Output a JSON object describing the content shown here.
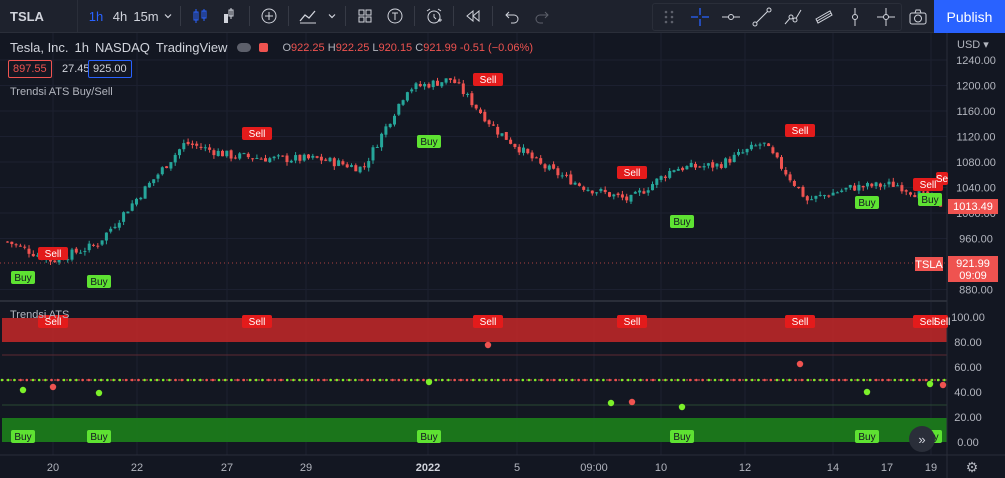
{
  "toolbar": {
    "symbol": "TSLA",
    "timeframes": [
      "1h",
      "4h",
      "15m"
    ],
    "active_timeframe": "1h",
    "publish_label": "Publish",
    "icons": [
      "chevron-down-icon",
      "candles-icon",
      "bars-icon",
      "add-icon",
      "line-chart-icon",
      "layout-icon",
      "templates-icon",
      "alert-icon",
      "replay-icon",
      "undo-icon",
      "redo-icon",
      "grid-dots-icon",
      "crosshair-icon",
      "horizontal-line-icon",
      "trend-line-icon",
      "path-icon",
      "channel-icon",
      "vertical-line-icon",
      "cross-line-icon",
      "camera-icon"
    ]
  },
  "legend": {
    "title": "Tesla, Inc.",
    "interval": "1h",
    "exchange": "NASDAQ",
    "source": "TradingView",
    "o_label": "O",
    "open": "922.25",
    "h_label": "H",
    "high": "922.25",
    "l_label": "L",
    "low": "920.15",
    "c_label": "C",
    "close": "921.99",
    "change": "-0.51 (−0.06%)",
    "bid": "897.55",
    "spread": "27.45",
    "ask": "925.00"
  },
  "price_pane": {
    "indicator_name": "Trendsi ATS Buy/Sell",
    "currency": "USD",
    "axis_ticks": [
      "1240.00",
      "1200.00",
      "1160.00",
      "1120.00",
      "1080.00",
      "1040.00",
      "1000.00",
      "960.00",
      "880.00"
    ],
    "last_price_label": "1013.49",
    "symbol_tag": "TSLA",
    "symbol_tag_price": "921.99",
    "symbol_tag_time": "09:09",
    "sell_labels": [
      "Sell",
      "Sell",
      "Sell",
      "Sell",
      "Sell",
      "Sell",
      "Se"
    ],
    "buy_labels": [
      "Buy",
      "Buy",
      "Buy",
      "Buy",
      "Buy",
      "Buy"
    ]
  },
  "oscillator_pane": {
    "indicator_name": "Trendsi ATS",
    "axis_ticks": [
      "100.00",
      "80.00",
      "60.00",
      "40.00",
      "20.00",
      "0.00"
    ],
    "sell_labels": [
      "Sell",
      "Sell",
      "Sell",
      "Sell",
      "Sell",
      "Sell",
      "Sell",
      "Se"
    ],
    "buy_labels": [
      "Buy",
      "Buy",
      "Buy",
      "Buy",
      "Buy",
      "Buy"
    ],
    "colors": {
      "overbought": "#d32f2f",
      "oversold": "#1b8a1b",
      "line": "#d1d4dc"
    }
  },
  "time_axis": {
    "labels": [
      "20",
      "22",
      "27",
      "29",
      "2022",
      "5",
      "09:00",
      "10",
      "12",
      "14",
      "17",
      "19"
    ]
  },
  "colors": {
    "up": "#26a69a",
    "down": "#ef5350",
    "accent": "#2962ff",
    "buy_label": "#5ee232",
    "sell_label": "#e31b1b"
  },
  "chart_data": {
    "type": "candlestick",
    "ylim": [
      860,
      1260
    ],
    "x_labels": [
      "20",
      "22",
      "27",
      "29",
      "2022",
      "5",
      "09:00",
      "10",
      "12",
      "14",
      "17",
      "19"
    ],
    "approx_close_path": [
      {
        "x": "20",
        "y": 955
      },
      {
        "x": "21",
        "y": 925
      },
      {
        "x": "22",
        "y": 950
      },
      {
        "x": "23",
        "y": 1030
      },
      {
        "x": "27",
        "y": 1110
      },
      {
        "x": "28",
        "y": 1090
      },
      {
        "x": "29",
        "y": 1085
      },
      {
        "x": "30",
        "y": 1085
      },
      {
        "x": "31",
        "y": 1070
      },
      {
        "x": "2022",
        "y": 1195
      },
      {
        "x": "4",
        "y": 1210
      },
      {
        "x": "5",
        "y": 1130
      },
      {
        "x": "09:00",
        "y": 1075
      },
      {
        "x": "7",
        "y": 1040
      },
      {
        "x": "10",
        "y": 1020
      },
      {
        "x": "11",
        "y": 1070
      },
      {
        "x": "12",
        "y": 1075
      },
      {
        "x": "13",
        "y": 1110
      },
      {
        "x": "14",
        "y": 1020
      },
      {
        "x": "17",
        "y": 1040
      },
      {
        "x": "18",
        "y": 1045
      },
      {
        "x": "19",
        "y": 1013.49
      }
    ],
    "oscillator": {
      "name": "Trendsi ATS",
      "ylim": [
        0,
        100
      ],
      "levels": [
        20,
        40,
        50,
        60,
        80
      ]
    }
  }
}
